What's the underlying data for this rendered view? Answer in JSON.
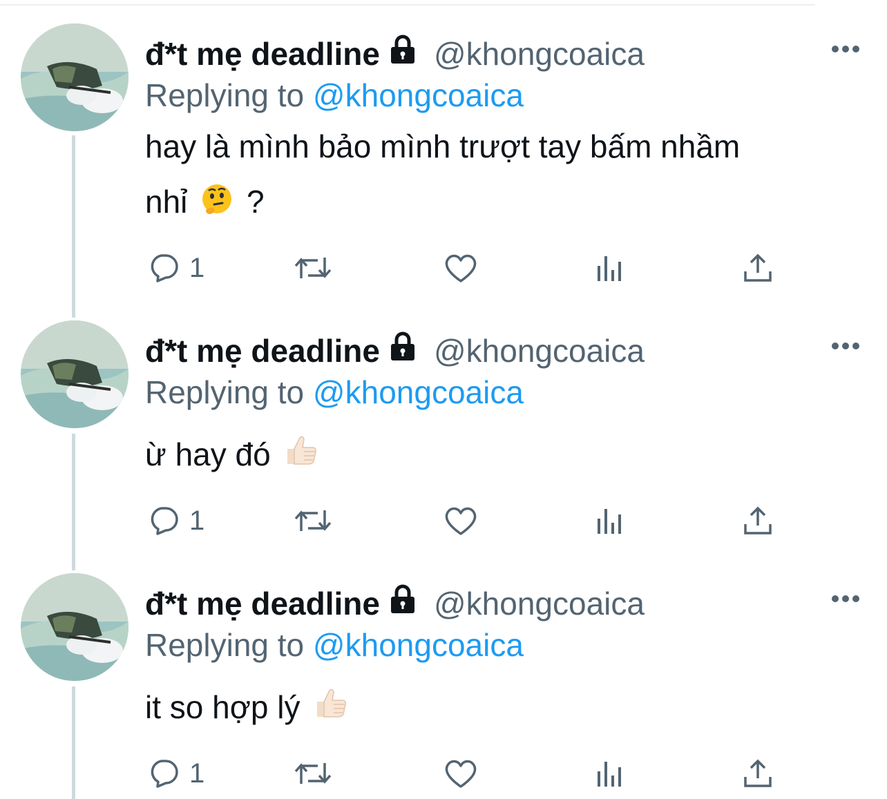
{
  "colors": {
    "text": "#0f1419",
    "secondary": "#536471",
    "mention": "#1d9bf0",
    "thread_line": "#cfd9de",
    "icon": "#536471"
  },
  "tweets": [
    {
      "display_name": "đ*t mẹ deadline",
      "handle": "@khongcoaica",
      "replying_prefix": "Replying to",
      "replying_mention": "@khongcoaica",
      "text_line1": "hay là mình bảo mình trượt tay bấm nhầm",
      "text_line2": "nhỉ",
      "text_line2_suffix": "?",
      "emoji": "thinking-face",
      "reply_count": "1"
    },
    {
      "display_name": "đ*t mẹ deadline",
      "handle": "@khongcoaica",
      "replying_prefix": "Replying to",
      "replying_mention": "@khongcoaica",
      "text_line1": "ừ hay đó",
      "emoji": "thumbs-up",
      "reply_count": "1"
    },
    {
      "display_name": "đ*t mẹ deadline",
      "handle": "@khongcoaica",
      "replying_prefix": "Replying to",
      "replying_mention": "@khongcoaica",
      "text_line1": "it so hợp lý",
      "emoji": "thumbs-up",
      "reply_count": "1"
    }
  ],
  "icons": {
    "avatar": "avatar-image",
    "lock": "lock-icon",
    "more": "more-icon",
    "reply": "reply-icon",
    "retweet": "retweet-icon",
    "like": "like-icon",
    "views": "views-icon",
    "share": "share-icon"
  }
}
